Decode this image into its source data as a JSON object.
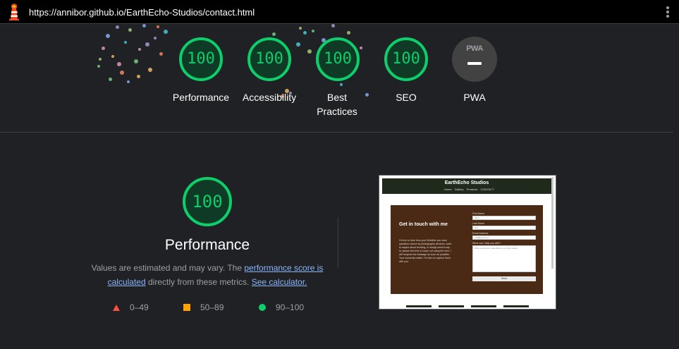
{
  "browser": {
    "url": "https://annibor.github.io/EarthEcho-Studios/contact.html",
    "app_icon": "lighthouse-icon",
    "menu_icon": "kebab-menu-icon"
  },
  "scores": [
    {
      "label": "Performance",
      "score": "100"
    },
    {
      "label": "Accessibility",
      "score": "100"
    },
    {
      "label": "Best Practices",
      "score": "100"
    },
    {
      "label": "SEO",
      "score": "100"
    }
  ],
  "pwa": {
    "label": "PWA",
    "badge_text": "PWA"
  },
  "performance": {
    "score": "100",
    "title": "Performance",
    "desc_part1": "Values are estimated and may vary. The ",
    "link1": "performance score is calculated",
    "desc_part2": " directly from these metrics. ",
    "link2": "See calculator."
  },
  "legend": [
    {
      "shape": "triangle",
      "range": "0–49",
      "color": "#ff4e42"
    },
    {
      "shape": "square",
      "range": "50–89",
      "color": "#ffa400"
    },
    {
      "shape": "circle",
      "range": "90–100",
      "color": "#0cce6b"
    }
  ],
  "thumbnail": {
    "brand": "EarthEcho Studios",
    "nav": "Home Gallery Products CONTACT",
    "heading": "Get in touch with me",
    "body": "I'd love to hear from you! Whether you have questions about my photography services, want to inquire about booking, or simply want to say hi, please feel free to reach out using the form. I will respond via message as soon as possible. Your moments matter, I'm here to capture them with you.",
    "fields": [
      "First Name",
      "Last Name",
      "Email Address",
      "What can I help you with?"
    ],
    "values": [
      "John",
      "Doe",
      "mail@mail.com"
    ],
    "textarea": "Write a prompt or ask about your photo needs",
    "button": "Send"
  },
  "colors": {
    "pass": "#0cce6b",
    "average": "#ffa400",
    "fail": "#ff4e42",
    "background": "#202124",
    "link": "#8ab4f8"
  }
}
